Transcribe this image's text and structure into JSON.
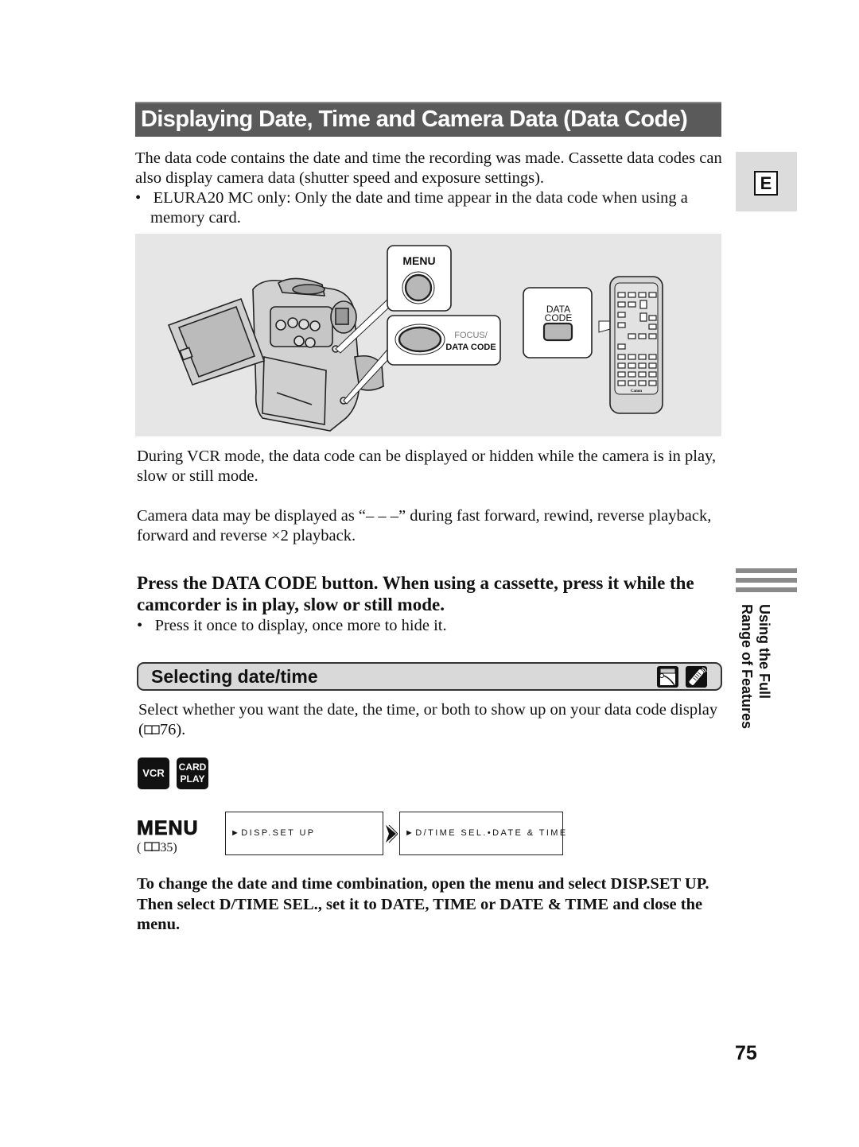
{
  "header": {
    "title": "Displaying Date, Time and Camera Data (Data Code)"
  },
  "language_tab": {
    "letter": "E"
  },
  "intro": {
    "paragraph": "The data code contains the date and time the recording was made. Cassette data codes can also display camera data (shutter speed and exposure settings).",
    "bullet": "ELURA20 MC only: Only the date and time appear in the data code when using a memory card.",
    "bullet_symbol": "•"
  },
  "figure": {
    "callout_menu_label": "MENU",
    "callout_focus_line1": "FOCUS/",
    "callout_focus_line2": "DATA CODE",
    "remote_callout_line1": "DATA",
    "remote_callout_line2": "CODE",
    "remote_brand": "Canon",
    "colors": {
      "background": "#e6e6e6",
      "button_fill": "#b8b8b8",
      "outline": "#222222",
      "focus_text": "#777777"
    }
  },
  "notes": {
    "vcr_mode": "During VCR mode, the data code can be displayed or hidden while the camera is in play, slow or still mode.",
    "camera_data": "Camera data may be displayed as “– – –” during fast forward, rewind, reverse playback, forward and reverse ×2 playback."
  },
  "step": {
    "instruction": "Press the DATA CODE button. When using a cassette, press it while the camcorder is in play, slow or still mode.",
    "bullet": "Press it once to display, once more to hide it.",
    "bullet_symbol": "•"
  },
  "side_tab": {
    "line1": "Using the Full",
    "line2": "Range of Features"
  },
  "section": {
    "title": "Selecting date/time",
    "icons": [
      "cassette-mode-icon",
      "remote-control-icon"
    ],
    "description_before_ref": "Select whether you want the date, the time, or both to show up on your data code display (",
    "description_ref_page": "76",
    "description_after_ref": ").",
    "mode_badges": {
      "vcr": "VCR",
      "card_line1": "CARD",
      "card_line2": "PLAY"
    },
    "menu_label": "MENU",
    "menu_ref_open": "( ",
    "menu_ref_page": "35",
    "menu_ref_close": ")",
    "menu_path": [
      {
        "marker": "►",
        "text": "DISP.SET UP"
      },
      {
        "marker": "►",
        "text": "D/TIME SEL.•DATE & TIME"
      }
    ],
    "closing_instruction": "To change the date and time combination, open the menu and select DISP.SET UP. Then select D/TIME SEL., set it to DATE, TIME or DATE & TIME and close the menu."
  },
  "footer": {
    "page_number": "75"
  },
  "colors": {
    "title_bar": "#5a5a5a",
    "section_bar": "#d9d9d9",
    "side_tab": "#dcdcdc",
    "side_bars": "#8a8a8a"
  }
}
